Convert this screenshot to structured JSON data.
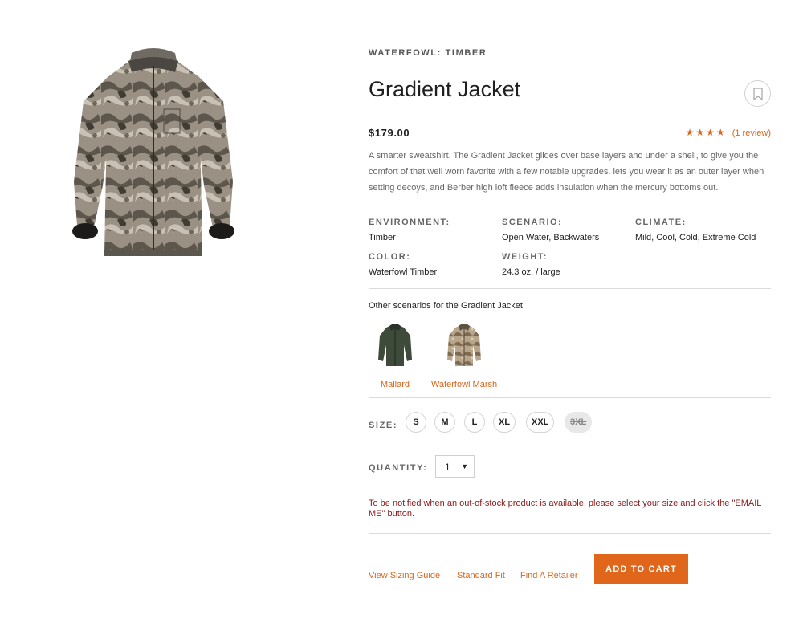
{
  "product": {
    "category": "WATERFOWL: TIMBER",
    "title": "Gradient Jacket",
    "price": "$179.00",
    "rating": {
      "stars": "★★★★",
      "star_count": 4,
      "reviews_label": "(1 review)"
    },
    "description": "A smarter sweatshirt. The Gradient Jacket glides over base layers and under a shell, to give you the comfort of that well worn favorite with a few notable upgrades. lets you wear it as an outer layer when setting decoys, and Berber high loft fleece adds insulation when the mercury bottoms out.",
    "image_icon": "jacket-image"
  },
  "specs": [
    {
      "label": "ENVIRONMENT:",
      "value": "Timber"
    },
    {
      "label": "SCENARIO:",
      "value": "Open Water, Backwaters"
    },
    {
      "label": "CLIMATE:",
      "value": "Mild, Cool, Cold, Extreme Cold"
    },
    {
      "label": "COLOR:",
      "value": "Waterfowl Timber"
    },
    {
      "label": "WEIGHT:",
      "value": "24.3 oz. / large"
    }
  ],
  "scenarios": {
    "heading": "Other scenarios for the Gradient Jacket",
    "items": [
      {
        "label": "Mallard",
        "icon": "green-jacket-thumbnail"
      },
      {
        "label": "Waterfowl Marsh",
        "icon": "marsh-camo-jacket-thumbnail"
      }
    ]
  },
  "size": {
    "label": "SIZE:",
    "options": [
      {
        "label": "S",
        "available": true
      },
      {
        "label": "M",
        "available": true
      },
      {
        "label": "L",
        "available": true
      },
      {
        "label": "XL",
        "available": true
      },
      {
        "label": "XXL",
        "available": true
      },
      {
        "label": "3XL",
        "available": false
      }
    ]
  },
  "quantity": {
    "label": "QUANTITY:",
    "value": "1",
    "caret": "▼"
  },
  "notice": "To be notified when an out-of-stock product is available, please select your size and click the \"EMAIL ME\" button.",
  "actions": {
    "sizing_guide": "View Sizing Guide",
    "fit": "Standard Fit",
    "retailer": "Find A Retailer",
    "add_to_cart": "ADD TO CART"
  },
  "colors": {
    "accent": "#e0661c",
    "link": "#d8671f",
    "notice": "#8b1a1a"
  }
}
